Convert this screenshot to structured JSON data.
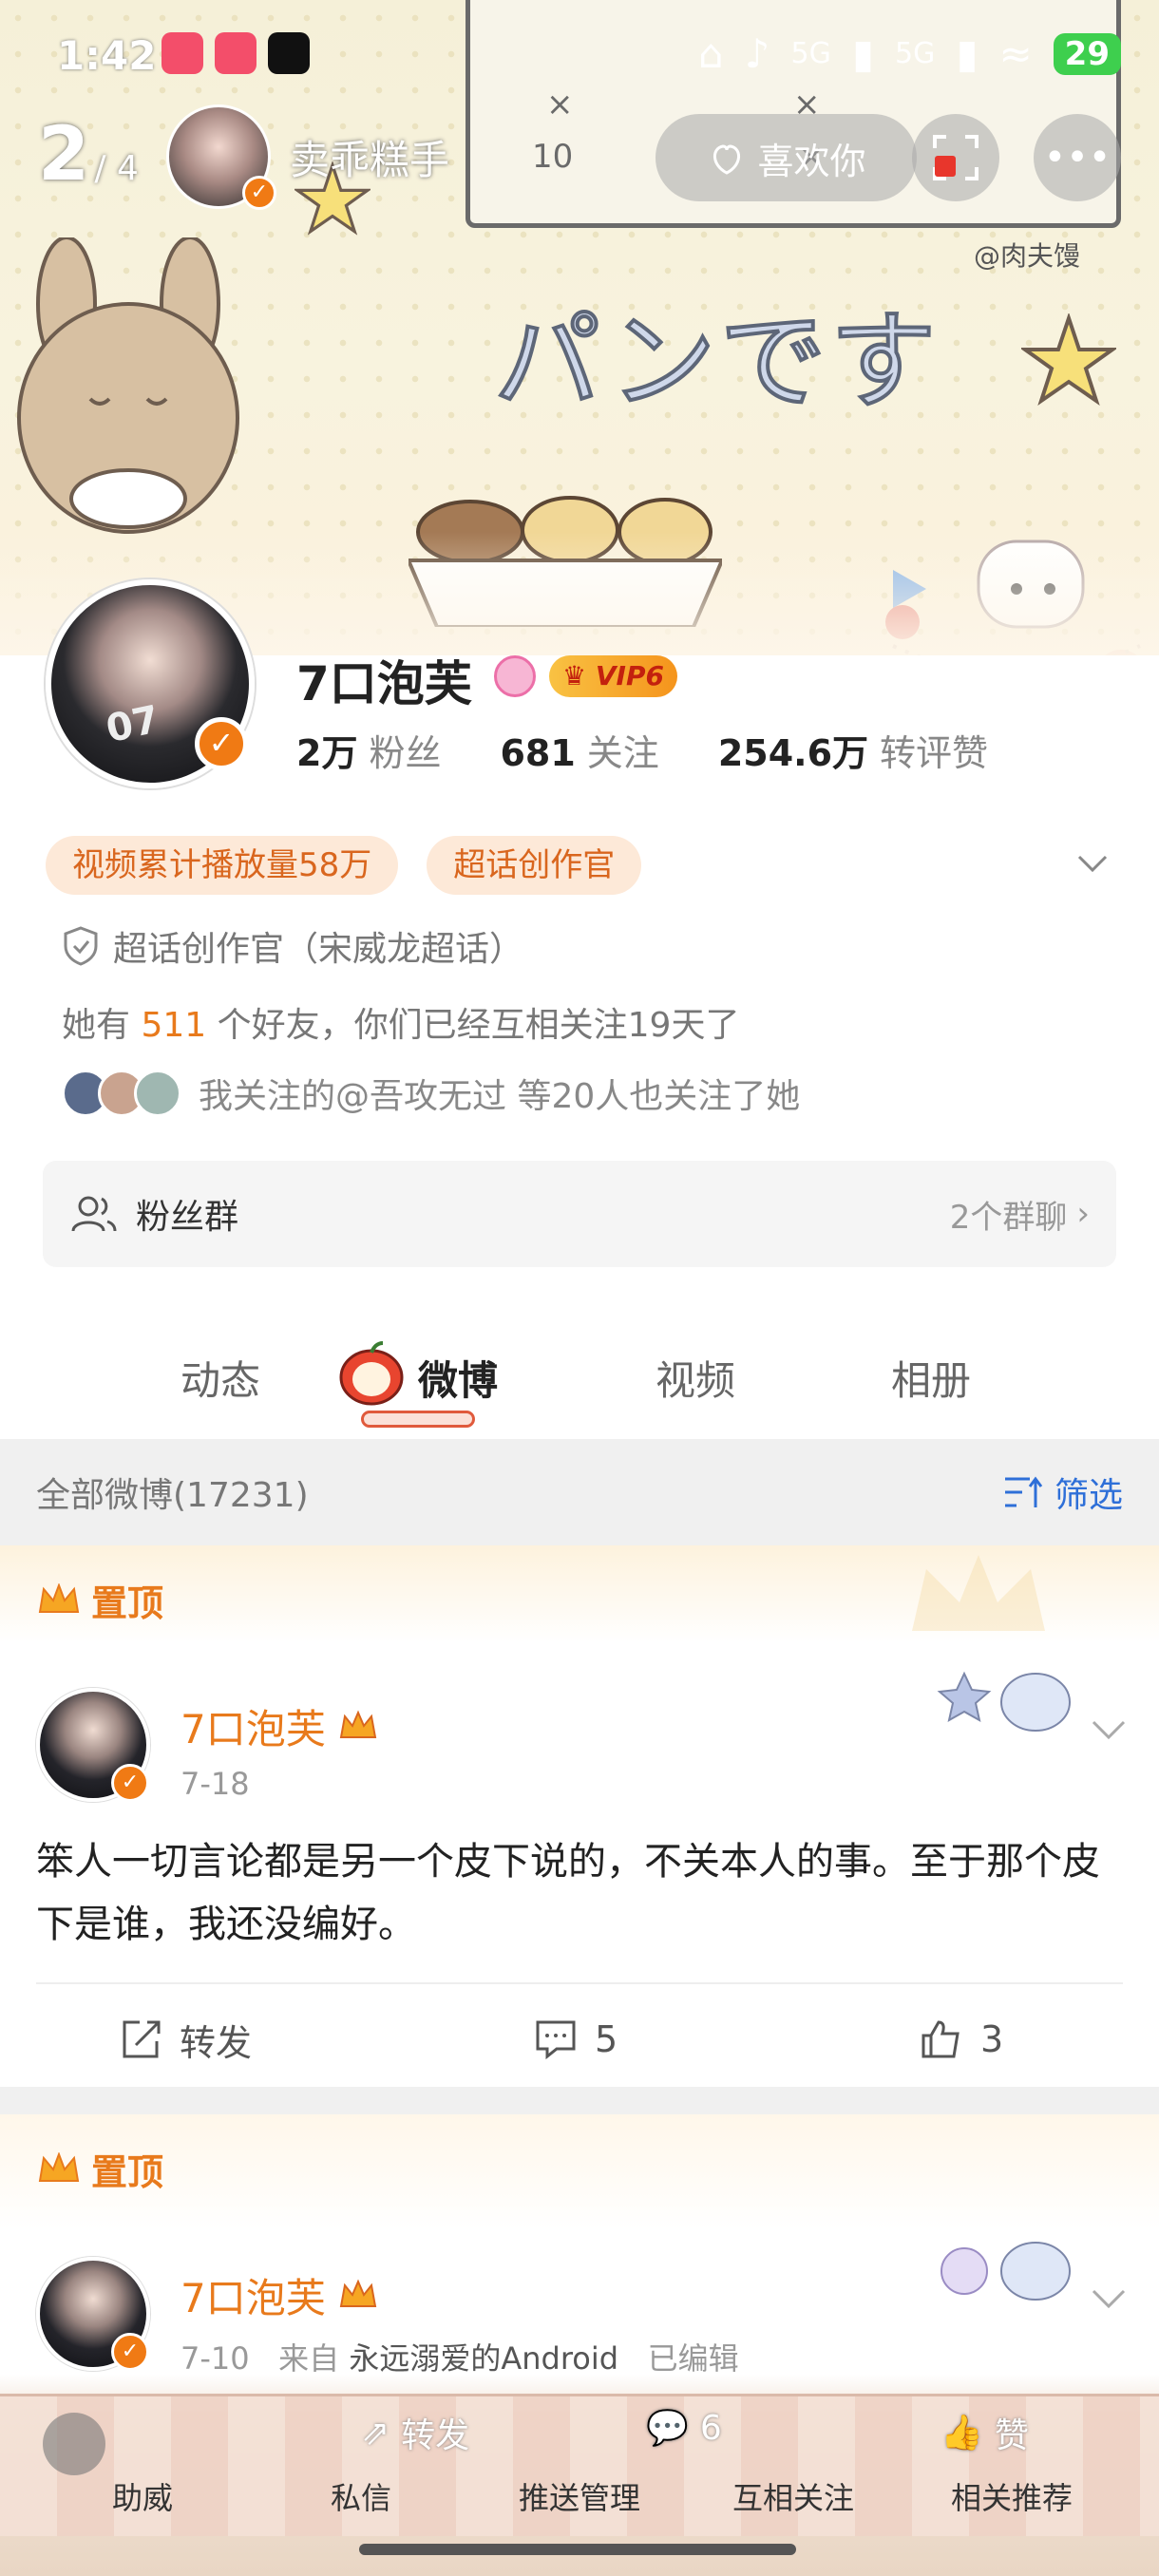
{
  "status_bar": {
    "time": "1:42",
    "net1": "5G",
    "net2": "5G",
    "battery": "29"
  },
  "top_nav": {
    "page_current": "2",
    "page_total": "/ 4",
    "user_name": "卖乖糕手",
    "like_label": "喜欢你"
  },
  "banner": {
    "text": "パンです",
    "watermark": "@肉夫馒"
  },
  "profile": {
    "name": "7口泡芙",
    "vip_label": "VIP6",
    "stats": [
      {
        "value": "2万",
        "label": "粉丝"
      },
      {
        "value": "681",
        "label": "关注"
      },
      {
        "value": "254.6万",
        "label": "转评赞"
      }
    ],
    "tags": [
      "视频累计播放量58万",
      "超话创作官"
    ],
    "verify": "超话创作官（宋威龙超话）",
    "friends_prefix": "她有",
    "friends_count": "511",
    "friends_suffix": "个好友，你们已经互相关注19天了",
    "mutual": "我关注的@吾攻无过 等20人也关注了她",
    "fan_group_label": "粉丝群",
    "fan_group_count": "2个群聊"
  },
  "tabs": [
    {
      "label": "动态"
    },
    {
      "label": "微博"
    },
    {
      "label": "视频"
    },
    {
      "label": "相册"
    }
  ],
  "feed": {
    "title": "全部微博(17231)",
    "filter_label": "筛选"
  },
  "posts": [
    {
      "pin_label": "置顶",
      "author": "7口泡芙",
      "date": "7-18",
      "text": "笨人一切言论都是另一个皮下说的，不关本人的事。至于那个皮下是谁，我还没编好。",
      "repost_label": "转发",
      "comments": "5",
      "likes": "3"
    },
    {
      "pin_label": "置顶",
      "author": "7口泡芙",
      "date": "7-10",
      "source_prefix": "来自",
      "source": "永远溺爱的Android",
      "edited": "已编辑"
    }
  ],
  "bottom_toolbar": {
    "overlay": {
      "repost": "转发",
      "comments": "6",
      "like": "赞"
    },
    "items": [
      "助威",
      "私信",
      "推送管理",
      "互相关注",
      "相关推荐"
    ]
  },
  "colors": {
    "accent": "#e87a1c",
    "link": "#2e6fd8",
    "vbadge": "#f07a14"
  }
}
